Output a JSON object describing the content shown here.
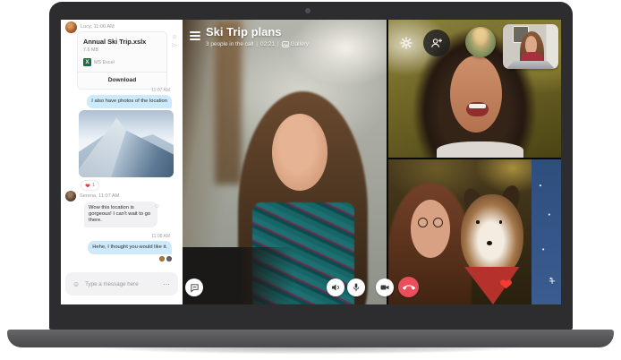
{
  "call": {
    "title": "Ski Trip plans",
    "participants": "3 people in the call",
    "separator": "|",
    "timer": "02:21",
    "gallery_label": "Gallery"
  },
  "chat": {
    "sender1": "Lucy, 11:00 AM",
    "file_card": {
      "title": "Annual Ski Trip.xslx",
      "size": "7.6 MB",
      "icon_letter": "X",
      "app_label": "MS Excel",
      "download_label": "Download"
    },
    "timestamp1": "11:07 AM",
    "sent_msg1": "I also have photos of the location",
    "reaction_count": "1",
    "sender2": "Serena, 11:07 AM",
    "received_msg1": "Wow this location is gorgeous! I can't wait to go there.",
    "timestamp2": "11:08 AM",
    "sent_msg2": "Hehe, I thought you would like it.",
    "input_placeholder": "Type a message here"
  },
  "icons": {
    "smiley": "☺",
    "ellipsis": "⋯",
    "forward": "▷",
    "plus": "+"
  },
  "colors": {
    "sent_bubble_blue": "#cdeafa",
    "received_bubble_gray": "#f1f1f4",
    "end_call_red": "#e94e5a",
    "heart_red": "#e8413c",
    "excel_green": "#1d6f42",
    "laptop_bezel": "#2d2d2f",
    "laptop_base": "#58585b"
  }
}
